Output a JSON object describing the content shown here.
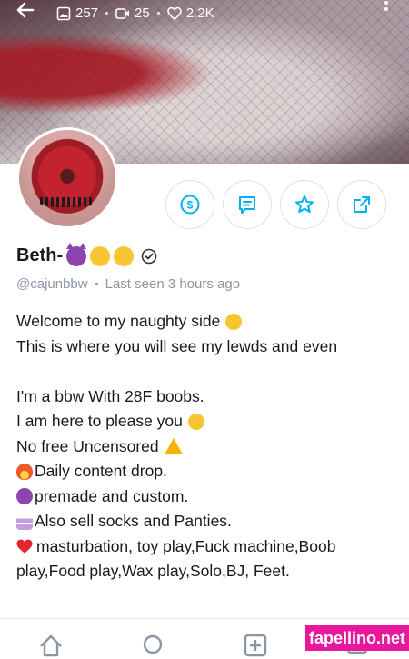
{
  "header": {
    "stats": [
      {
        "icon": "image-icon",
        "value": "257"
      },
      {
        "icon": "video-icon",
        "value": "25"
      },
      {
        "icon": "heart-icon",
        "value": "2.2K"
      }
    ]
  },
  "profile": {
    "name": "Beth-",
    "handle": "@cajunbbw",
    "last_seen": "Last seen 3 hours ago"
  },
  "actions": [
    {
      "name": "tip-button",
      "icon": "dollar-icon"
    },
    {
      "name": "message-button",
      "icon": "chat-icon"
    },
    {
      "name": "favorite-button",
      "icon": "star-icon"
    },
    {
      "name": "share-button",
      "icon": "share-icon"
    }
  ],
  "bio": {
    "lines": [
      "Welcome to my naughty side",
      "This is where you will see my lewds and even",
      "",
      "I'm a bbw With 28F boobs.",
      "I am here to please you",
      "No free Uncensored",
      "Daily content drop.",
      "premade and custom.",
      "Also sell socks and Panties.",
      "masturbation, toy play,Fuck machine,Boob",
      "play,Food play,Wax play,Solo,BJ, Feet."
    ]
  },
  "bottom_nav": [
    "home-icon",
    "search-icon",
    "add-post-icon",
    "messages-icon"
  ],
  "watermark": "fapellino.net",
  "colors": {
    "accent": "#00aff0",
    "muted": "#8a96a3",
    "watermark": "#e8179b"
  }
}
